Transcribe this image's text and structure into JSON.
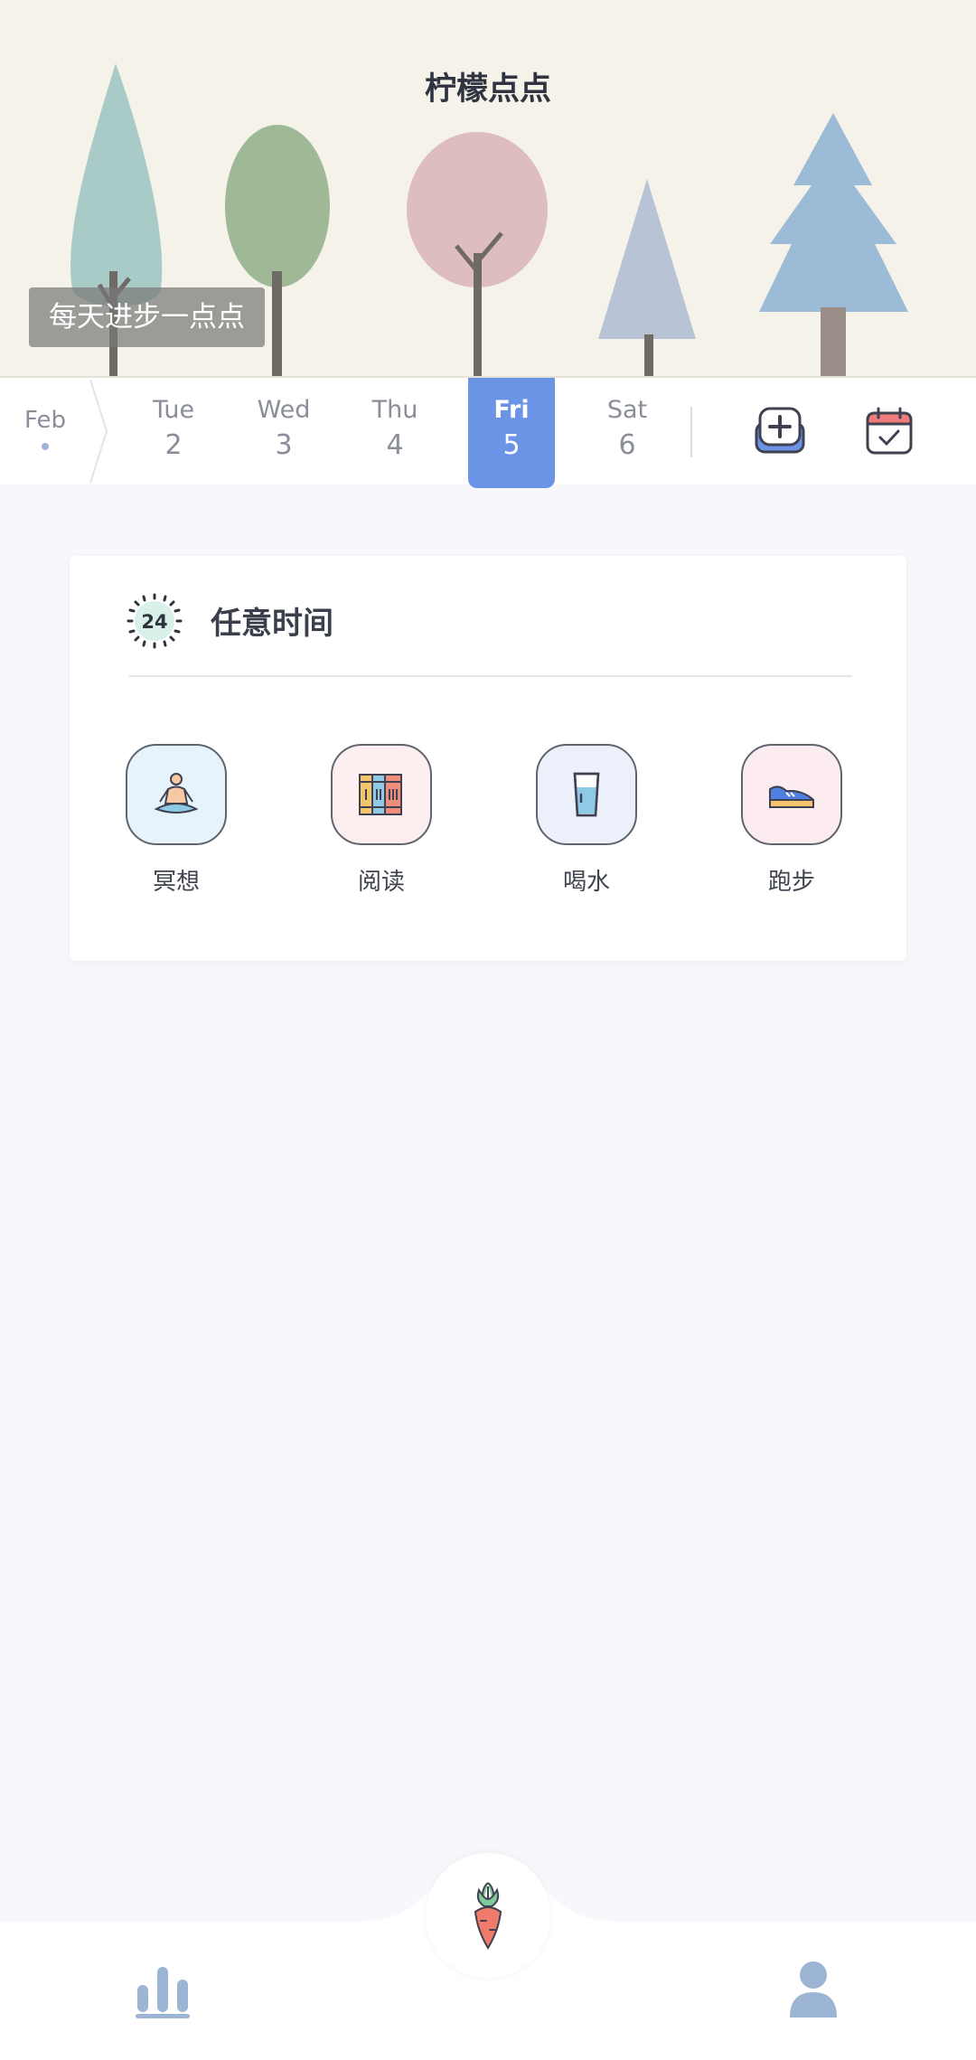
{
  "header": {
    "title": "柠檬点点",
    "slogan": "每天进步一点点"
  },
  "calendar": {
    "month": "Feb",
    "days": [
      {
        "name": "Tue",
        "date": "2"
      },
      {
        "name": "Wed",
        "date": "3"
      },
      {
        "name": "Thu",
        "date": "4"
      },
      {
        "name": "Fri",
        "date": "5",
        "selected": true
      },
      {
        "name": "Sat",
        "date": "6"
      }
    ],
    "accent": "#6b93e6"
  },
  "section": {
    "icon_text": "24",
    "title": "任意时间",
    "habits": [
      {
        "label": "冥想",
        "icon": "meditation-icon",
        "bg": "#e6f3fb"
      },
      {
        "label": "阅读",
        "icon": "books-icon",
        "bg": "#fdeef0"
      },
      {
        "label": "喝水",
        "icon": "water-glass-icon",
        "bg": "#ecf0fb"
      },
      {
        "label": "跑步",
        "icon": "sneaker-icon",
        "bg": "#fcecef"
      }
    ]
  },
  "tabbar": {
    "left": "stats-icon",
    "center": "carrot-icon",
    "right": "profile-icon"
  }
}
